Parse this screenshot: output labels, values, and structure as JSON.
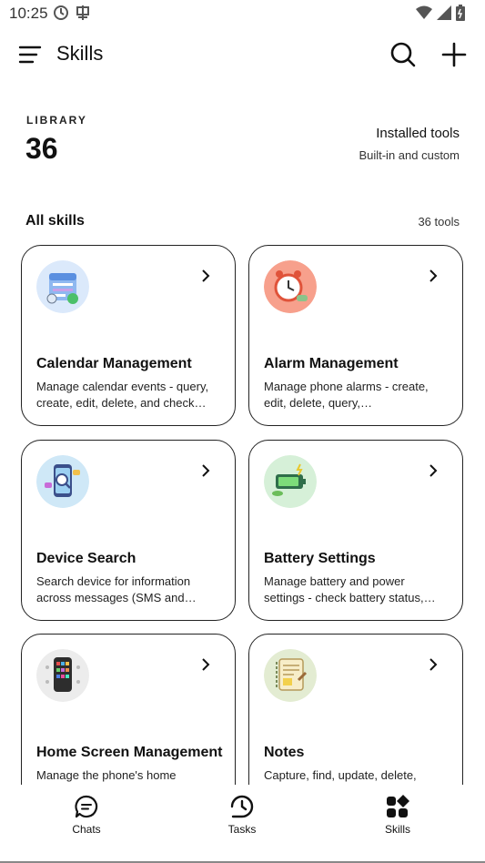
{
  "status_bar": {
    "time": "10:25"
  },
  "app_bar": {
    "title": "Skills"
  },
  "library": {
    "label": "LIBRARY",
    "count": "36",
    "installed_title": "Installed tools",
    "installed_subtitle": "Built-in and custom"
  },
  "section": {
    "title": "All skills",
    "count_label": "36 tools"
  },
  "cards": [
    {
      "title": "Calendar Management",
      "description": "Manage calendar events - query, create, edit, delete, and check conflicts",
      "icon": "calendar-icon"
    },
    {
      "title": "Alarm Management",
      "description": "Manage phone alarms - create, edit, delete, query, enable/disable alarms",
      "icon": "alarm-clock-icon"
    },
    {
      "title": "Device Search",
      "description": "Search device for information across messages (SMS and more)",
      "icon": "phone-search-icon"
    },
    {
      "title": "Battery Settings",
      "description": "Manage battery and power settings - check battery status, power saving",
      "icon": "battery-icon"
    },
    {
      "title": "Home Screen Management",
      "description": "Manage the phone's home screen",
      "icon": "phone-apps-icon"
    },
    {
      "title": "Notes",
      "description": "Capture, find, update, delete, and",
      "icon": "notebook-icon"
    }
  ],
  "nav": [
    {
      "label": "Chats",
      "icon": "chat-bubble-icon"
    },
    {
      "label": "Tasks",
      "icon": "tasks-clock-icon"
    },
    {
      "label": "Skills",
      "icon": "skills-grid-icon"
    }
  ],
  "colors": {
    "background": "#ffffff",
    "card_border": "#222222",
    "text": "#111111"
  }
}
